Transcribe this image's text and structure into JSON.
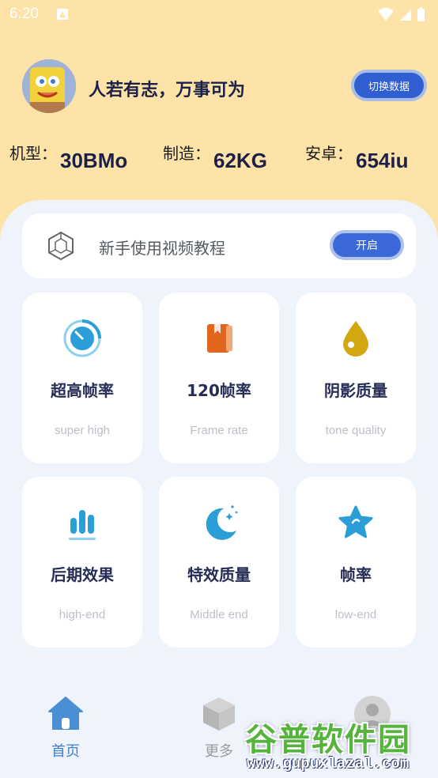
{
  "status_bar": {
    "time": "6:20"
  },
  "header": {
    "title": "人若有志，万事可为",
    "switch_button": "切换数据",
    "specs": [
      {
        "label": "机型：",
        "value": "30BMo"
      },
      {
        "label": "制造：",
        "value": "62KG"
      },
      {
        "label": "安卓：",
        "value": "654iu"
      }
    ]
  },
  "tutorial": {
    "text": "新手使用视频教程",
    "button": "开启"
  },
  "cards": [
    {
      "title": "超高帧率",
      "subtitle": "super high",
      "icon": "timer-icon"
    },
    {
      "title": "120帧率",
      "subtitle": "Frame rate",
      "icon": "book-icon"
    },
    {
      "title": "阴影质量",
      "subtitle": "tone quality",
      "icon": "drop-icon"
    },
    {
      "title": "后期效果",
      "subtitle": "high-end",
      "icon": "bar-chart-icon"
    },
    {
      "title": "特效质量",
      "subtitle": "Middle end",
      "icon": "moon-icon"
    },
    {
      "title": "帧率",
      "subtitle": "low-end",
      "icon": "star-icon"
    }
  ],
  "bottom_nav": [
    {
      "label": "首页",
      "icon": "home-icon",
      "active": true
    },
    {
      "label": "更多",
      "icon": "cube-icon",
      "active": false
    },
    {
      "label": "",
      "icon": "profile-icon",
      "active": false
    }
  ],
  "watermark": {
    "big": "谷普软件园",
    "small": "www.gupuxlazal.com"
  },
  "colors": {
    "header_bg": "#fde3a8",
    "panel_bg": "#eff3fc",
    "accent": "#3b6ad8",
    "icon_blue": "#2b9ed8",
    "icon_orange": "#e1651d",
    "icon_gold": "#d3a712"
  }
}
